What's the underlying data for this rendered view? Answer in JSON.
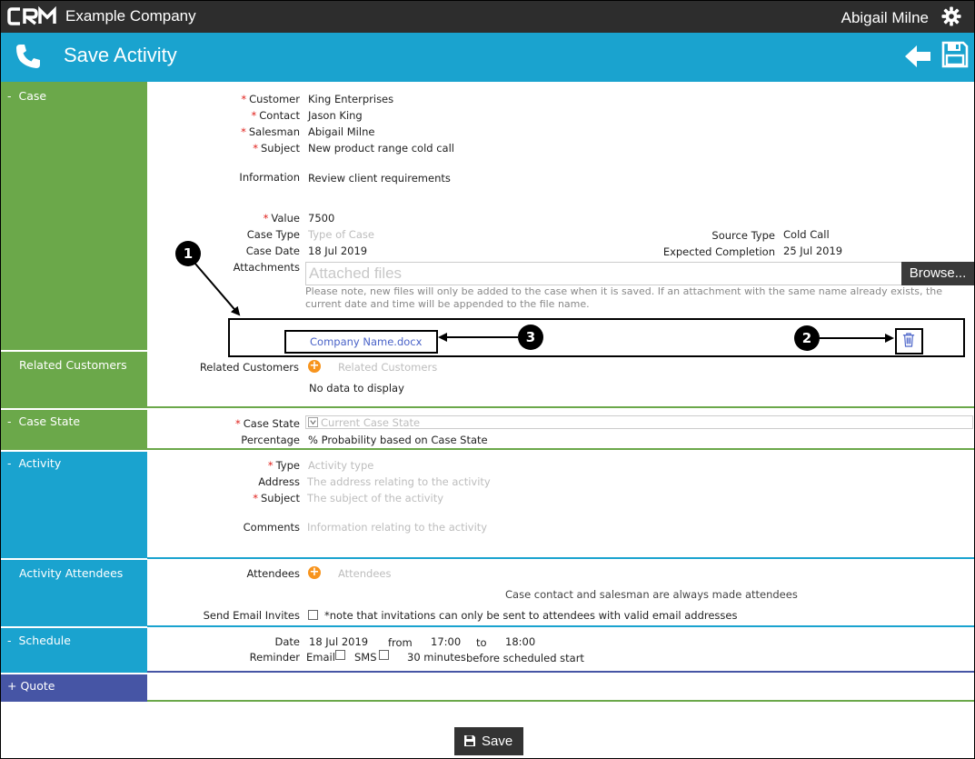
{
  "header": {
    "logo_text": "CRM",
    "company": "Example Company",
    "user": "Abigail Milne",
    "title": "Save Activity"
  },
  "sections": {
    "case": "Case",
    "related_customers": "Related Customers",
    "case_state": "Case State",
    "activity": "Activity",
    "activity_attendees": "Activity Attendees",
    "schedule": "Schedule",
    "quote": "Quote",
    "collapse_mark": "-",
    "expand_mark": "+"
  },
  "case": {
    "customer_label": "Customer",
    "customer_value": "King Enterprises",
    "contact_label": "Contact",
    "contact_value": "Jason King",
    "salesman_label": "Salesman",
    "salesman_value": "Abigail Milne",
    "subject_label": "Subject",
    "subject_value": "New product range cold call",
    "information_label": "Information",
    "information_value": "Review client requirements",
    "value_label": "Value",
    "value_value": "7500",
    "case_type_label": "Case Type",
    "case_type_placeholder": "Type of Case",
    "case_date_label": "Case Date",
    "case_date_value": "18 Jul 2019",
    "source_type_label": "Source Type",
    "source_type_value": "Cold Call",
    "expected_completion_label": "Expected Completion",
    "expected_completion_value": "25 Jul 2019",
    "attachments_label": "Attachments",
    "attachments_placeholder": "Attached files",
    "browse_label": "Browse...",
    "attachments_note": "Please note, new files will only be added to the case when it is saved. If an attachment with the same name already exists, the current date and time will be appended to the file name.",
    "attached_file": "Company Name.docx"
  },
  "callouts": {
    "one": "1",
    "two": "2",
    "three": "3"
  },
  "related_customers": {
    "label": "Related Customers",
    "placeholder": "Related Customers",
    "empty": "No data to display"
  },
  "case_state": {
    "label": "Case State",
    "placeholder": "Current Case State",
    "percentage_label": "Percentage",
    "percentage_value": "% Probability based on Case State"
  },
  "activity": {
    "type_label": "Type",
    "type_placeholder": "Activity type",
    "address_label": "Address",
    "address_placeholder": "The address relating to the activity",
    "subject_label": "Subject",
    "subject_placeholder": "The subject of the activity",
    "comments_label": "Comments",
    "comments_placeholder": "Information relating to the activity"
  },
  "attendees": {
    "label": "Attendees",
    "placeholder": "Attendees",
    "note": "Case contact and salesman are always made attendees",
    "send_invites_label": "Send Email Invites",
    "send_invites_note": "*note that invitations can only be sent to attendees with valid email addresses"
  },
  "schedule": {
    "date_label": "Date",
    "date_value": "18 Jul 2019",
    "from_label": "from",
    "from_value": "17:00",
    "to_label": "to",
    "to_value": "18:00",
    "reminder_label": "Reminder",
    "email_label": "Email",
    "sms_label": "SMS",
    "minutes_value": "30 minutes",
    "before_label": "before scheduled start"
  },
  "footer": {
    "save_label": "Save"
  },
  "colors": {
    "topbar": "#2d2d2d",
    "titlebar": "#1aa3cf",
    "green": "#6ba84a",
    "blue": "#1aa3cf",
    "purple": "#4655a5",
    "required": "#e0201b",
    "add": "#f7941d",
    "link": "#4a63c8"
  }
}
